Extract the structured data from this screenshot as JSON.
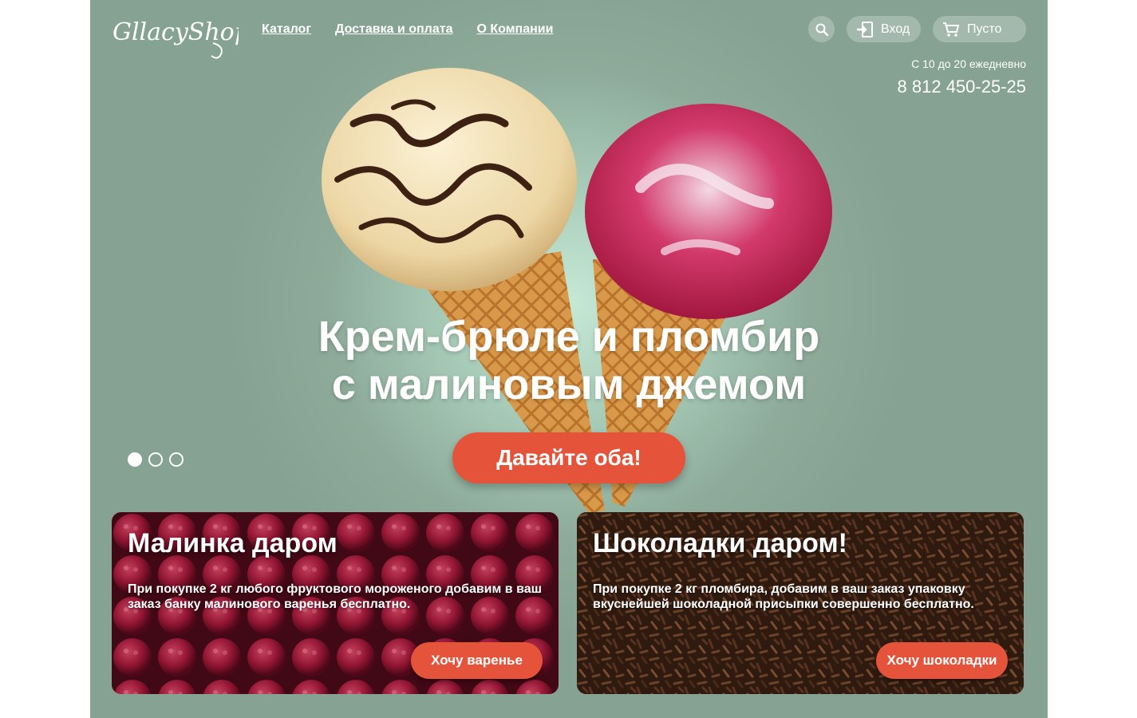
{
  "header": {
    "logo_text": "GllacyShop",
    "nav": [
      {
        "label": "Каталог"
      },
      {
        "label": "Доставка и оплата"
      },
      {
        "label": "О Компании"
      }
    ],
    "search_icon": "search-icon",
    "login_label": "Вход",
    "cart_label": "Пусто",
    "hours": "С 10 до 20 ежедневно",
    "phone": "8 812 450-25-25"
  },
  "hero": {
    "title_line1": "Крем-брюле и пломбир",
    "title_line2": "с малиновым джемом",
    "cta_label": "Давайте оба!",
    "slides_total": 3,
    "slide_active": 1
  },
  "promos": [
    {
      "title": "Малинка даром",
      "text": "При покупке 2 кг любого фруктового мороженого добавим в ваш заказ банку малинового варенья бесплатно.",
      "button": "Хочу варенье"
    },
    {
      "title": "Шоколадки даром!",
      "text": "При покупке 2 кг пломбира, добавим в ваш заказ упаковку вкуснейшей шоколадной присыпки совершенно бесплатно.",
      "button": "Хочу шоколадки"
    }
  ],
  "colors": {
    "background": "#8aa595",
    "accent": "#e4533a",
    "text": "#ffffff"
  }
}
